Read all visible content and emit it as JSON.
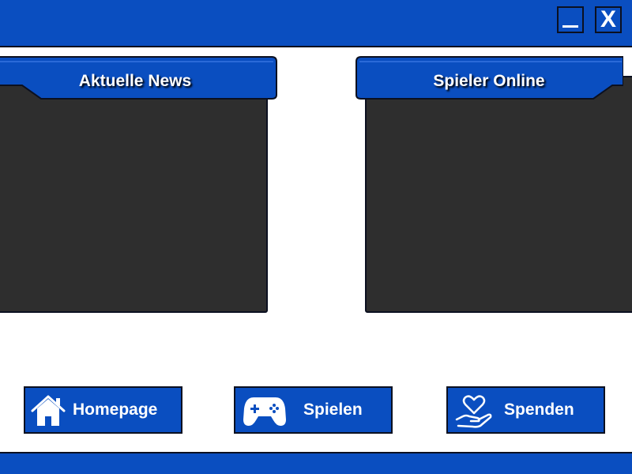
{
  "window": {
    "minimize_label": "",
    "close_label": "X"
  },
  "panels": {
    "news": {
      "title": "Aktuelle News"
    },
    "online": {
      "title": "Spieler Online"
    }
  },
  "nav": {
    "home_label": "Homepage",
    "play_label": "Spielen",
    "donate_label": "Spenden"
  },
  "colors": {
    "primary": "#0a4ec0",
    "panel": "#2e2e2e",
    "border": "#0b1020",
    "text": "#ffffff"
  },
  "icons": {
    "home": "house-icon",
    "play": "gamepad-icon",
    "donate": "heart-hand-icon"
  }
}
